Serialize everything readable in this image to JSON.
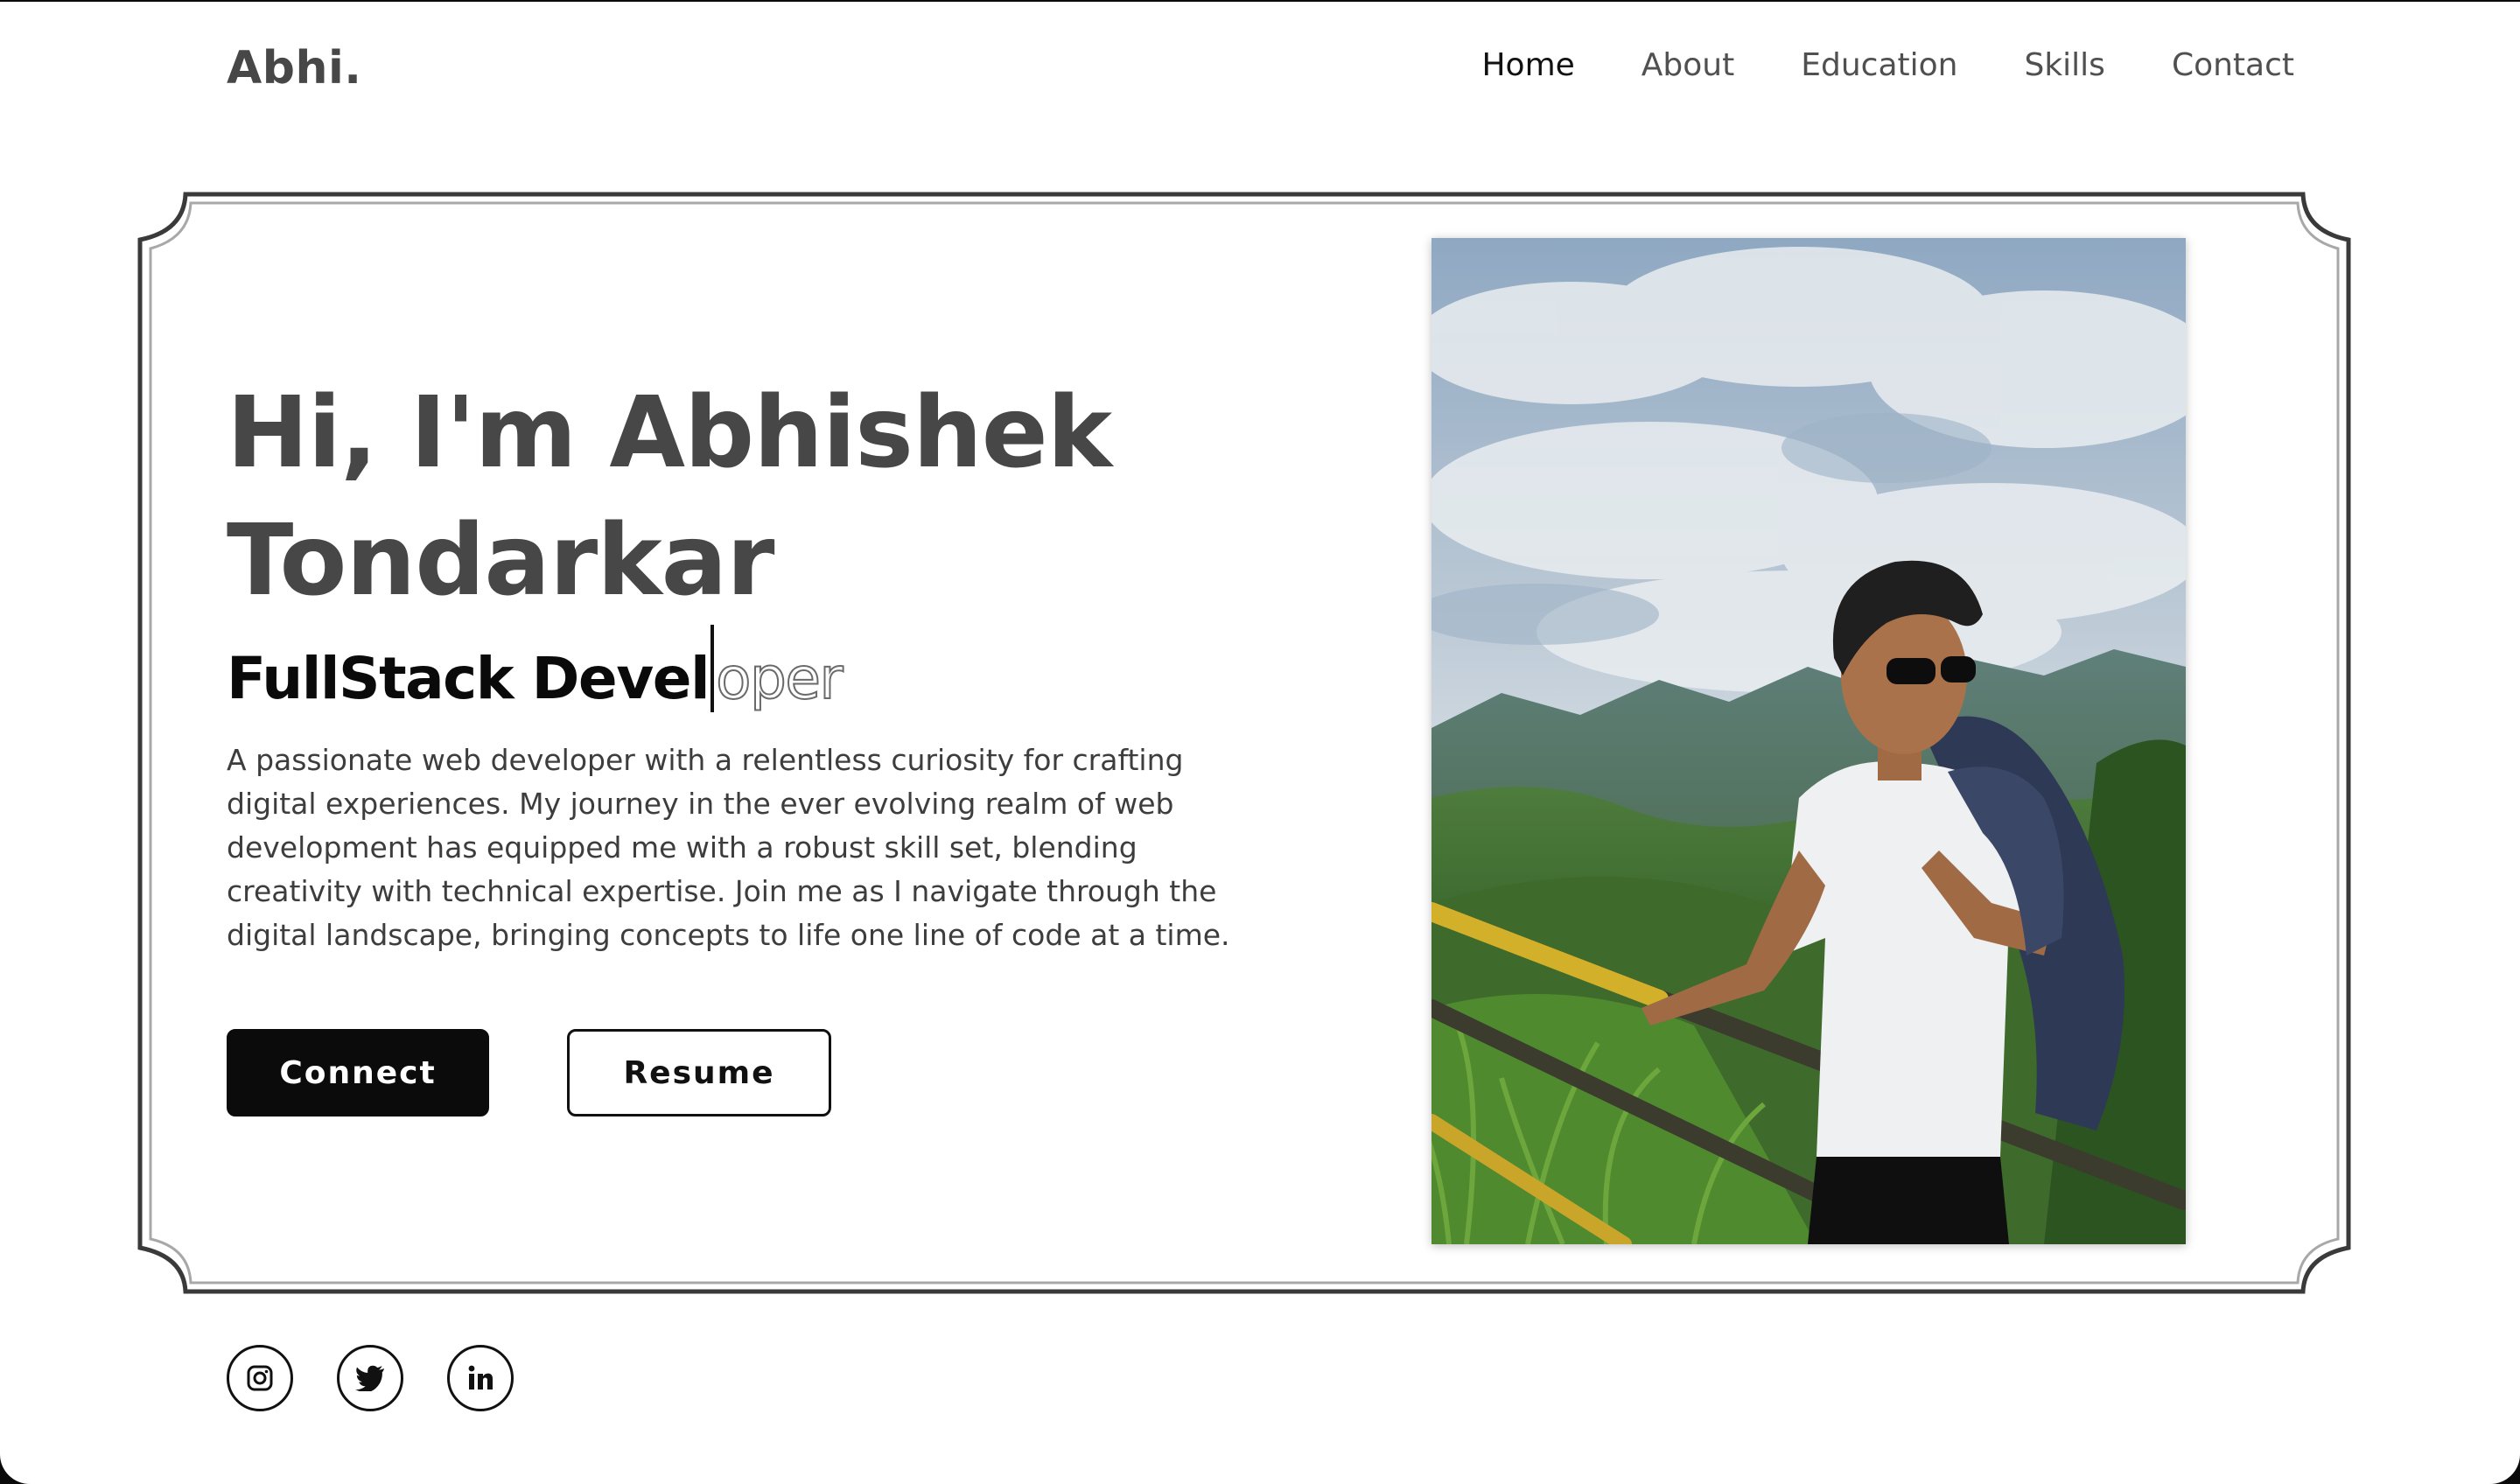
{
  "brand": {
    "logo": "Abhi."
  },
  "nav": {
    "items": [
      {
        "label": "Home",
        "active": true
      },
      {
        "label": "About"
      },
      {
        "label": "Education"
      },
      {
        "label": "Skills"
      },
      {
        "label": "Contact"
      }
    ]
  },
  "hero": {
    "title": "Hi, I'm Abhishek Tondarkar",
    "role_typed": "FullStack Devel",
    "role_remaining": "oper",
    "bio": "A passionate web developer with a relentless curiosity for crafting digital experiences. My journey in the ever evolving realm of web development has equipped me with a robust skill set, blending creativity with technical expertise. Join me as I navigate through the digital landscape, bringing concepts to life one line of code at a time.",
    "connect_label": "Connect",
    "resume_label": "Resume"
  },
  "social": {
    "icons": [
      "instagram-icon",
      "twitter-icon",
      "linkedin-icon"
    ]
  },
  "colors": {
    "text_dark": "#474747",
    "button_dark": "#0b0b0b",
    "background": "#ffffff"
  }
}
